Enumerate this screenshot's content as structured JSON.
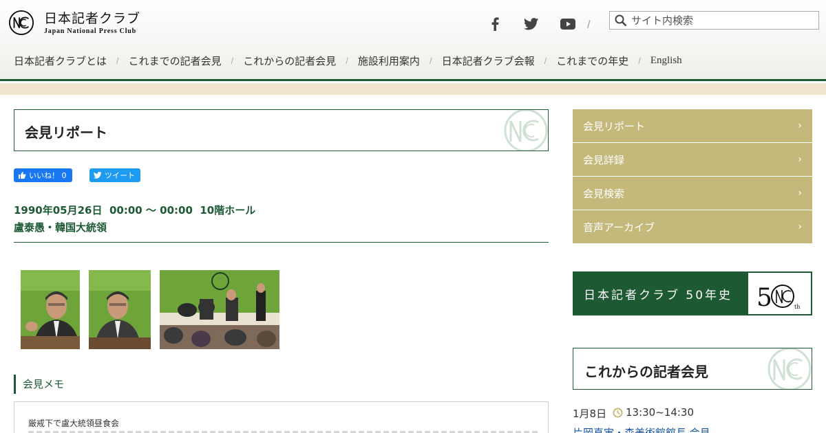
{
  "header": {
    "logo_jp": "日本記者クラブ",
    "logo_en": "Japan National Press Club",
    "search_placeholder": "サイト内検索"
  },
  "social": [
    "facebook-icon",
    "twitter-icon",
    "youtube-icon"
  ],
  "nav": [
    "日本記者クラブとは",
    "これまでの記者会見",
    "これからの記者会見",
    "施設利用案内",
    "日本記者クラブ会報",
    "これまでの年史",
    "English"
  ],
  "main": {
    "title": "会見リポート",
    "like_label": "いいね！ 0",
    "tweet_label": "ツイート",
    "date_line": "1990年05月26日  00:00 〜 00:00  10階ホール",
    "speaker": "盧泰愚・韓国大統領",
    "memo_heading": "会見メモ",
    "memo_text": "厳戒下で盧大統領昼食会"
  },
  "sidebar": {
    "menu": [
      "会見リポート",
      "会見詳録",
      "会見検索",
      "音声アーカイブ"
    ],
    "banner_text": "日本記者クラブ 50年史",
    "upcoming_title": "これからの記者会見",
    "event": {
      "date": "1月8日",
      "time": "13:30~14:30",
      "title": "片岡真実・森美術館館長 会見"
    }
  },
  "colors": {
    "brand_green": "#1d5a34",
    "gold": "#c4b97a",
    "band": "#efe6cd",
    "link_blue": "#1a55a6"
  }
}
